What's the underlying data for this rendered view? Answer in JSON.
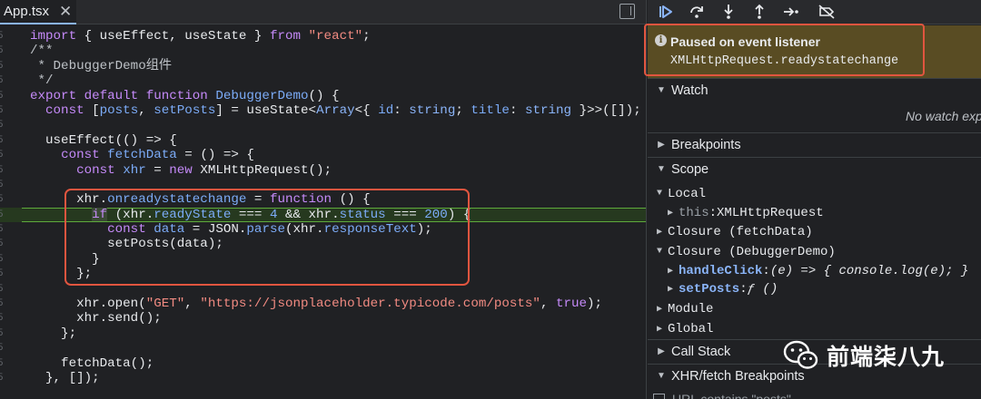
{
  "editor": {
    "tab": {
      "filename": "App.tsx",
      "close_glyph": "✕"
    },
    "code_lines": [
      "import { useEffect, useState } from \"react\";",
      "/**",
      " * DebuggerDemo组件",
      " */",
      "export default function DebuggerDemo() {",
      "  const [posts, setPosts] = useState<Array<{ id: string; title: string }>>([]);",
      "",
      "  useEffect(() => {",
      "    const fetchData = () => {",
      "      const xhr = new XMLHttpRequest();",
      "",
      "      xhr.onreadystatechange = function () {",
      "        if (xhr.readyState === 4 && xhr.status === 200) {",
      "          const data = JSON.parse(xhr.responseText);",
      "          setPosts(data);",
      "        }",
      "      };",
      "",
      "      xhr.open(\"GET\", \"https://jsonplaceholder.typicode.com/posts\", true);",
      "      xhr.send();",
      "    };",
      "",
      "    fetchData();",
      "  }, []);"
    ],
    "paused_line_index": 12
  },
  "debugger": {
    "toolbar": [
      {
        "name": "resume-button",
        "icon": "resume-icon"
      },
      {
        "name": "step-over-button",
        "icon": "step-over-icon"
      },
      {
        "name": "step-into-button",
        "icon": "step-into-icon"
      },
      {
        "name": "step-out-button",
        "icon": "step-out-icon"
      },
      {
        "name": "step-button",
        "icon": "step-icon"
      },
      {
        "name": "deactivate-breakpoints-button",
        "icon": "breakpoints-off-icon"
      }
    ],
    "pause": {
      "icon": "i",
      "title": "Paused on event listener",
      "detail": "XMLHttpRequest.readystatechange"
    },
    "sections": {
      "watch": "Watch",
      "watch_empty": "No watch expressions",
      "breakpoints": "Breakpoints",
      "scope": "Scope",
      "call_stack": "Call Stack",
      "xhr": "XHR/fetch Breakpoints"
    },
    "scope": {
      "local": "Local",
      "this_name": "this",
      "this_value": "XMLHttpRequest",
      "closure1": "Closure (fetchData)",
      "closure2": "Closure (DebuggerDemo)",
      "handle_name": "handleClick",
      "handle_value": "(e) => { console.log(e); }",
      "setposts_name": "setPosts",
      "setposts_value": "ƒ ()",
      "module": "Module",
      "global": "Global"
    },
    "xhr_row": "URL contains \"posts\""
  },
  "watermark": {
    "text": "前端柒八九",
    "icon": "wechat-icon"
  },
  "colors": {
    "highlight_border": "#e1553f",
    "paused_banner": "#594c23",
    "exec_line_border": "#5eaa3c"
  }
}
